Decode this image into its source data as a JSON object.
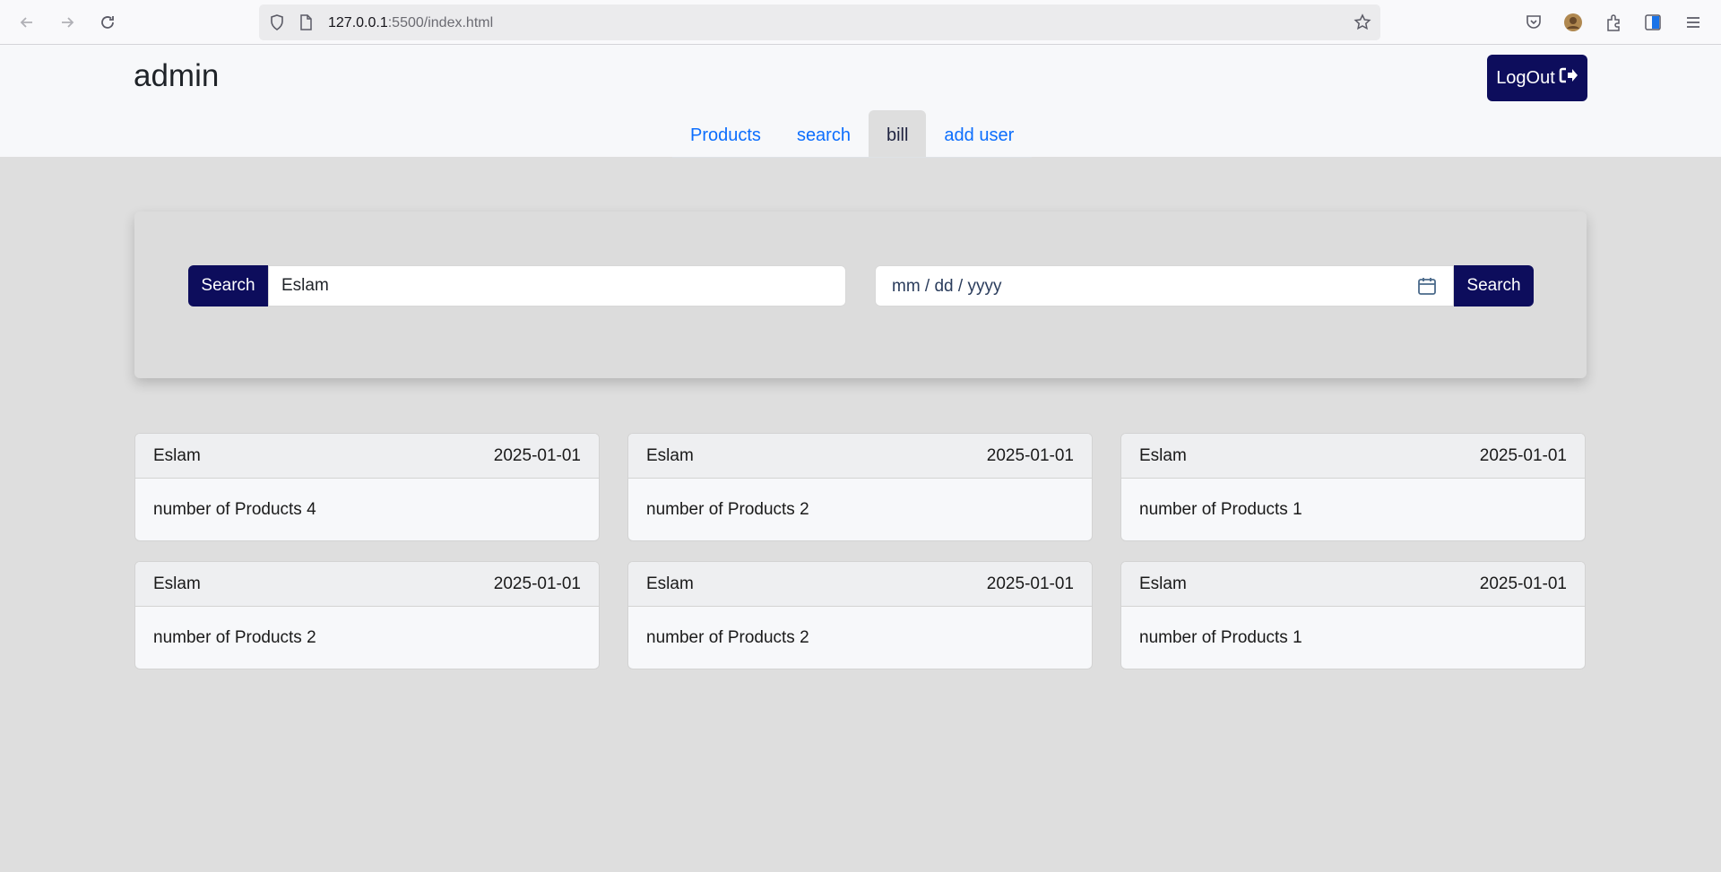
{
  "browser": {
    "url_host": "127.0.0.1",
    "url_rest": ":5500/index.html"
  },
  "header": {
    "brand": "admin",
    "logout_label": "LogOut"
  },
  "tabs": [
    {
      "label": "Products",
      "active": false
    },
    {
      "label": "search",
      "active": false
    },
    {
      "label": "bill",
      "active": true
    },
    {
      "label": "add user",
      "active": false
    }
  ],
  "search": {
    "name_button": "Search",
    "name_value": "Eslam",
    "date_placeholder": "mm / dd / yyyy",
    "date_button": "Search"
  },
  "bills": [
    {
      "name": "Eslam",
      "date": "2025-01-01",
      "products": "number of Products 4"
    },
    {
      "name": "Eslam",
      "date": "2025-01-01",
      "products": "number of Products 2"
    },
    {
      "name": "Eslam",
      "date": "2025-01-01",
      "products": "number of Products 1"
    },
    {
      "name": "Eslam",
      "date": "2025-01-01",
      "products": "number of Products 2"
    },
    {
      "name": "Eslam",
      "date": "2025-01-01",
      "products": "number of Products 2"
    },
    {
      "name": "Eslam",
      "date": "2025-01-01",
      "products": "number of Products 1"
    }
  ],
  "colors": {
    "primary_dark": "#0d0d5c",
    "link": "#0d6efd",
    "page_bg": "#dedede"
  }
}
